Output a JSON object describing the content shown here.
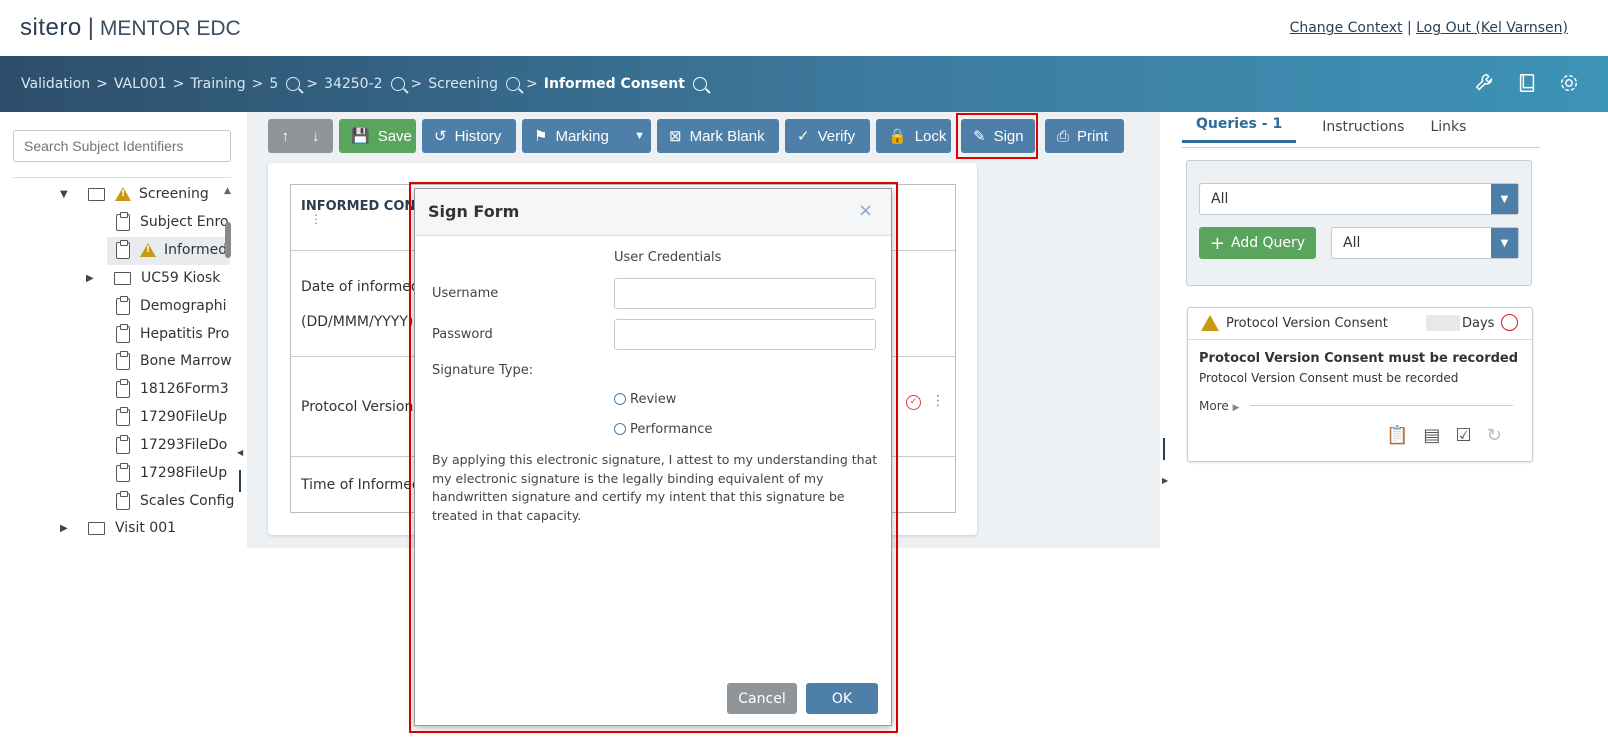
{
  "header": {
    "brand": "sitero",
    "product": "MENTOR EDC",
    "change_context": "Change Context",
    "separator": "|",
    "logout": "Log Out (Kel Varnsen)"
  },
  "breadcrumb": {
    "items": [
      "Validation",
      "VAL001",
      "Training",
      "5",
      "34250-2",
      "Screening"
    ],
    "current": "Informed Consent",
    "sep": ">"
  },
  "sidebar": {
    "search_placeholder": "Search Subject Identifiers",
    "tree": [
      {
        "label": "Screening"
      },
      {
        "label": "Subject Enro"
      },
      {
        "label": "Informed"
      },
      {
        "label": "UC59 Kiosk"
      },
      {
        "label": "Demographi"
      },
      {
        "label": "Hepatitis Pro"
      },
      {
        "label": "Bone Marrow"
      },
      {
        "label": "18126Form3"
      },
      {
        "label": "17290FileUp"
      },
      {
        "label": "17293FileDo"
      },
      {
        "label": "17298FileUp"
      },
      {
        "label": "Scales Config"
      },
      {
        "label": "Visit 001"
      }
    ]
  },
  "toolbar": {
    "up": "↑",
    "down": "↓",
    "save": "Save",
    "history": "History",
    "marking": "Marking",
    "mark_blank": "Mark Blank",
    "verify": "Verify",
    "lock": "Lock",
    "sign": "Sign",
    "print": "Print"
  },
  "form": {
    "title": "INFORMED CONS",
    "row1_label": "Date of informed",
    "row1_format": "(DD/MMM/YYYY)",
    "row2_label": "Protocol Version",
    "row3_label": "Time of Informed"
  },
  "right_panel": {
    "tabs": [
      "Queries - 1",
      "Instructions",
      "Links"
    ],
    "filter1": "All",
    "filter2": "All",
    "add_query": "Add Query",
    "query": {
      "title": "Protocol Version Consent",
      "days": "Days",
      "bold_text": "Protocol Version Consent must be recorded",
      "text": "Protocol Version Consent must be recorded",
      "more": "More"
    }
  },
  "modal": {
    "title": "Sign Form",
    "close": "×",
    "credentials_header": "User Credentials",
    "username_label": "Username",
    "password_label": "Password",
    "signature_type_label": "Signature Type:",
    "options": [
      "Review",
      "Performance"
    ],
    "attestation": "By applying this electronic signature, I attest to my understanding that my electronic signature is the legally binding equivalent of my handwritten signature and certify my intent that this signature be treated in that capacity.",
    "cancel": "Cancel",
    "ok": "OK"
  },
  "colors": {
    "accent": "#4d7fa8",
    "green": "#5aa55e",
    "highlight": "#e00000",
    "warning": "#c79a12"
  }
}
